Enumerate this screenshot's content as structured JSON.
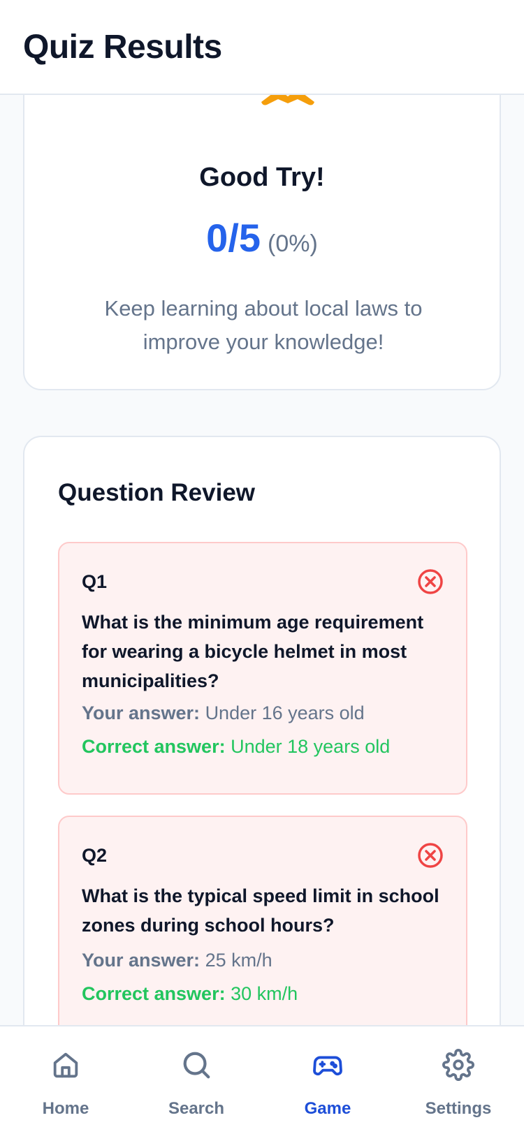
{
  "header": {
    "title": "Quiz Results"
  },
  "result": {
    "title": "Good Try!",
    "score": "0/5",
    "percent": "(0%)",
    "message": "Keep learning about local laws to improve your knowledge!"
  },
  "review": {
    "title": "Question Review",
    "questions": [
      {
        "number": "Q1",
        "text": "What is the minimum age requirement for wearing a bicycle helmet in most municipalities?",
        "your_label": "Your answer:",
        "your_answer": "Under 16 years old",
        "correct_label": "Correct answer:",
        "correct_answer": "Under 18 years old",
        "status_icon": "x-circle-icon"
      },
      {
        "number": "Q2",
        "text": "What is the typical speed limit in school zones during school hours?",
        "your_label": "Your answer:",
        "your_answer": "25 km/h",
        "correct_label": "Correct answer:",
        "correct_answer": "30 km/h",
        "status_icon": "x-circle-icon"
      }
    ]
  },
  "tabs": [
    {
      "label": "Home",
      "icon": "home-icon",
      "active": false
    },
    {
      "label": "Search",
      "icon": "search-icon",
      "active": false
    },
    {
      "label": "Game",
      "icon": "gamepad-icon",
      "active": true
    },
    {
      "label": "Settings",
      "icon": "gear-icon",
      "active": false
    }
  ],
  "colors": {
    "accent": "#2563eb",
    "error": "#ef4444",
    "success": "#22c55e",
    "muted": "#64748b",
    "trophy": "#f59e0b"
  }
}
